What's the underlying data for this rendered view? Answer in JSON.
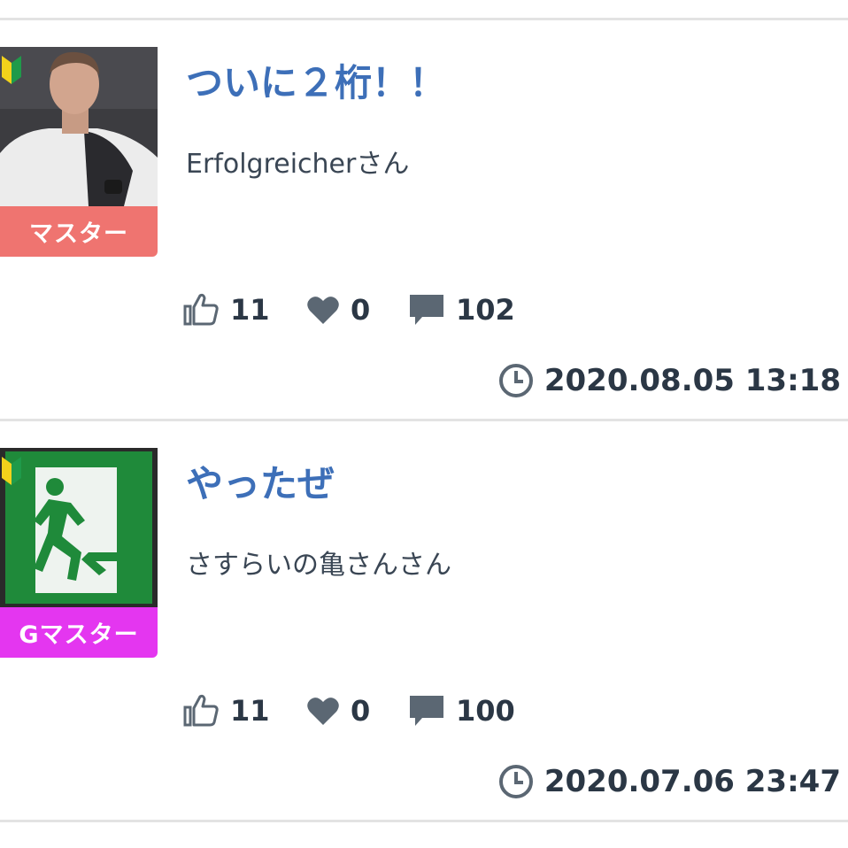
{
  "colors": {
    "title": "#3d6fb8",
    "text": "#2b3745",
    "icon": "#5b6773",
    "badge_master": "#ef7470",
    "badge_gmaster": "#e436f0"
  },
  "posts": [
    {
      "title": "ついに２桁！！",
      "author": "Erfolgreicherさん",
      "rank": "マスター",
      "rank_color": "#ef7470",
      "avatar_icon": "person-photo-icon",
      "likes": "11",
      "favorites": "0",
      "comments": "102",
      "datetime": "2020.08.05 13:18"
    },
    {
      "title": "やったぜ",
      "author": "さすらいの亀さんさん",
      "rank": "Gマスター",
      "rank_color": "#e436f0",
      "avatar_icon": "emergency-exit-sign-icon",
      "likes": "11",
      "favorites": "0",
      "comments": "100",
      "datetime": "2020.07.06 23:47"
    }
  ]
}
